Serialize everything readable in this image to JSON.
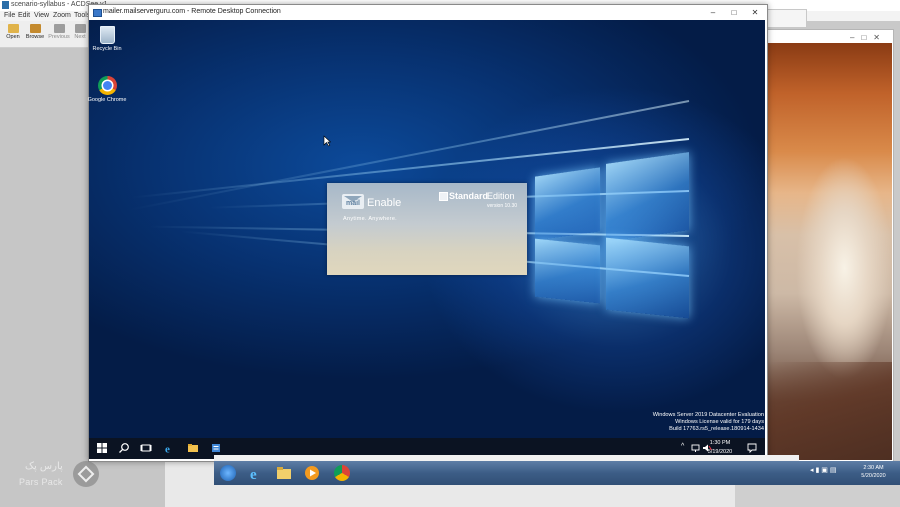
{
  "acdsee": {
    "title": "scenario-syllabus - ACDSee v1",
    "menu": [
      "File",
      "Edit",
      "View",
      "Zoom",
      "Tools"
    ],
    "toolbar": [
      {
        "label": "Open",
        "icon": "open-folder-icon",
        "enabled": true
      },
      {
        "label": "Browse",
        "icon": "browse-icon",
        "enabled": true
      },
      {
        "label": "Previous",
        "icon": "previous-icon",
        "enabled": false
      },
      {
        "label": "Next",
        "icon": "next-icon",
        "enabled": false
      }
    ]
  },
  "rdp": {
    "title": "mailer.mailserverguru.com - Remote Desktop Connection",
    "controls": {
      "minimize": "–",
      "maximize": "□",
      "close": "✕"
    }
  },
  "desktop": {
    "icons": [
      {
        "label": "Recycle Bin",
        "icon": "recycle-bin-icon"
      },
      {
        "label": "Google Chrome",
        "icon": "chrome-icon"
      }
    ],
    "watermark": [
      "Windows Server 2019 Datacenter Evaluation",
      "Windows License valid for 179 days",
      "Build 17763.rs5_release.180914-1434"
    ]
  },
  "splash": {
    "brand_mail": "mail",
    "brand_enable": "Enable",
    "tagline": "Anytime.  Anywhere.",
    "edition_bold": "Standard",
    "edition_rest": "Edition",
    "version": "version 10.30"
  },
  "remote_taskbar": {
    "time": "1:30 PM",
    "date": "5/19/2020"
  },
  "host_taskbar": {
    "time": "2:30 AM",
    "date": "5/20/2020"
  },
  "parspack": {
    "fa": "پارس پک",
    "en": "Pars Pack"
  },
  "colors": {
    "desktop_dark": "#041c47",
    "desktop_light": "#4aa6ff",
    "host_taskbar": "#3c5d86",
    "remote_taskbar": "#0b1322"
  }
}
